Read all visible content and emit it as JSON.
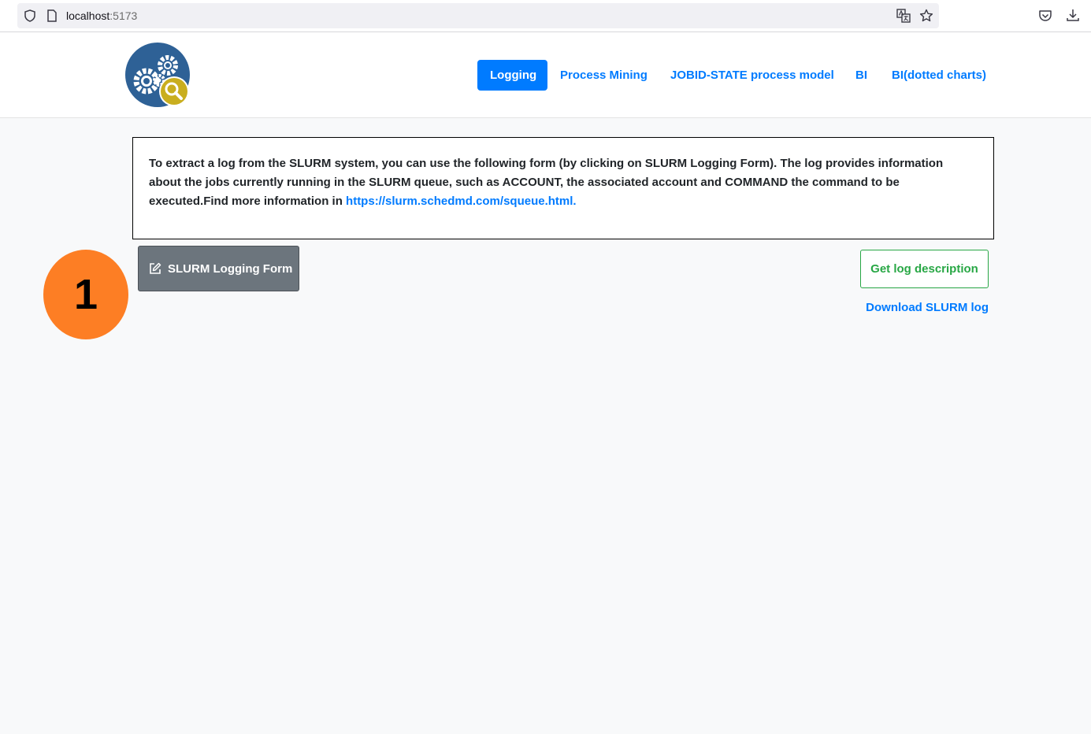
{
  "browser": {
    "url_host": "localhost",
    "url_port": ":5173"
  },
  "nav": {
    "items": [
      {
        "label": "Logging",
        "active": true
      },
      {
        "label": "Process Mining",
        "active": false
      },
      {
        "label": "JOBID-STATE process model",
        "active": false
      },
      {
        "label": "BI",
        "active": false
      },
      {
        "label": "BI(dotted charts)",
        "active": false
      }
    ]
  },
  "info": {
    "text": "To extract a log from the SLURM system, you can use the following form (by clicking on SLURM Logging Form). The log provides information about the jobs currently running in the SLURM queue, such as ACCOUNT, the associated account and COMMAND the command to be executed.Find more information in ",
    "link_text": "https://slurm.schedmd.com/squeue.html."
  },
  "actions": {
    "form_button_label": "SLURM Logging Form",
    "description_button_label": "Get log description",
    "download_link_label": "Download SLURM log"
  },
  "annotation": {
    "step_number": "1"
  },
  "colors": {
    "primary": "#007bff",
    "success": "#28a745",
    "secondary": "#6c757d",
    "badge": "#fd7e24"
  }
}
